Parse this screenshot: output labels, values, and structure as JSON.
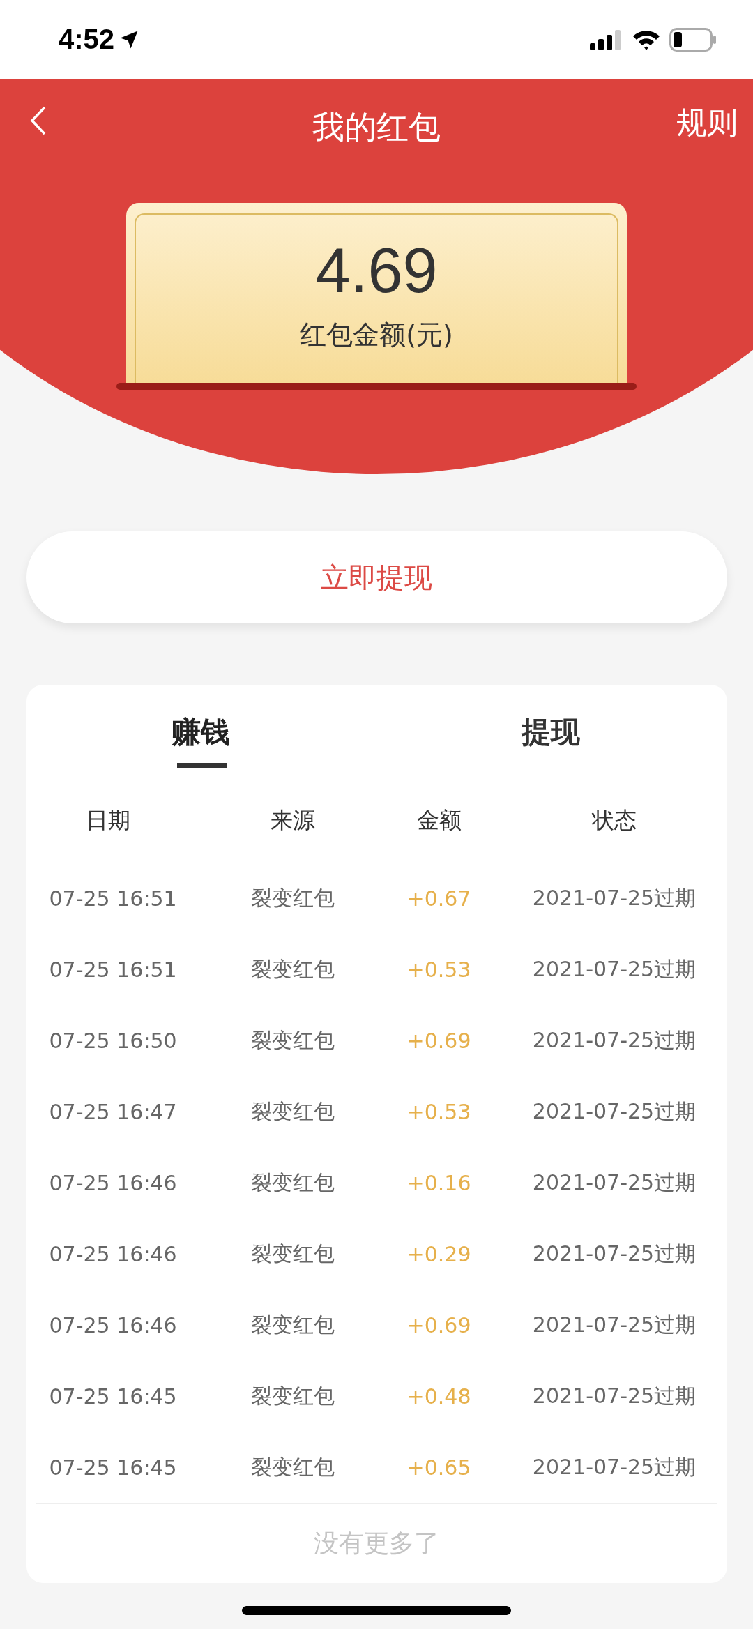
{
  "status_bar": {
    "time": "4:52"
  },
  "header": {
    "title": "我的红包",
    "rules_link": "规则"
  },
  "balance": {
    "amount": "4.69",
    "label": "红包金额(元)"
  },
  "withdraw_button": "立即提现",
  "tabs": [
    {
      "label": "赚钱",
      "selected": true
    },
    {
      "label": "提现",
      "selected": false
    }
  ],
  "table": {
    "columns": [
      "日期",
      "来源",
      "金额",
      "状态"
    ],
    "rows": [
      {
        "date": "07-25 16:51",
        "source": "裂变红包",
        "amount": "+0.67",
        "status": "2021-07-25过期"
      },
      {
        "date": "07-25 16:51",
        "source": "裂变红包",
        "amount": "+0.53",
        "status": "2021-07-25过期"
      },
      {
        "date": "07-25 16:50",
        "source": "裂变红包",
        "amount": "+0.69",
        "status": "2021-07-25过期"
      },
      {
        "date": "07-25 16:47",
        "source": "裂变红包",
        "amount": "+0.53",
        "status": "2021-07-25过期"
      },
      {
        "date": "07-25 16:46",
        "source": "裂变红包",
        "amount": "+0.16",
        "status": "2021-07-25过期"
      },
      {
        "date": "07-25 16:46",
        "source": "裂变红包",
        "amount": "+0.29",
        "status": "2021-07-25过期"
      },
      {
        "date": "07-25 16:46",
        "source": "裂变红包",
        "amount": "+0.69",
        "status": "2021-07-25过期"
      },
      {
        "date": "07-25 16:45",
        "source": "裂变红包",
        "amount": "+0.48",
        "status": "2021-07-25过期"
      },
      {
        "date": "07-25 16:45",
        "source": "裂变红包",
        "amount": "+0.65",
        "status": "2021-07-25过期"
      }
    ],
    "footer": "没有更多了"
  }
}
